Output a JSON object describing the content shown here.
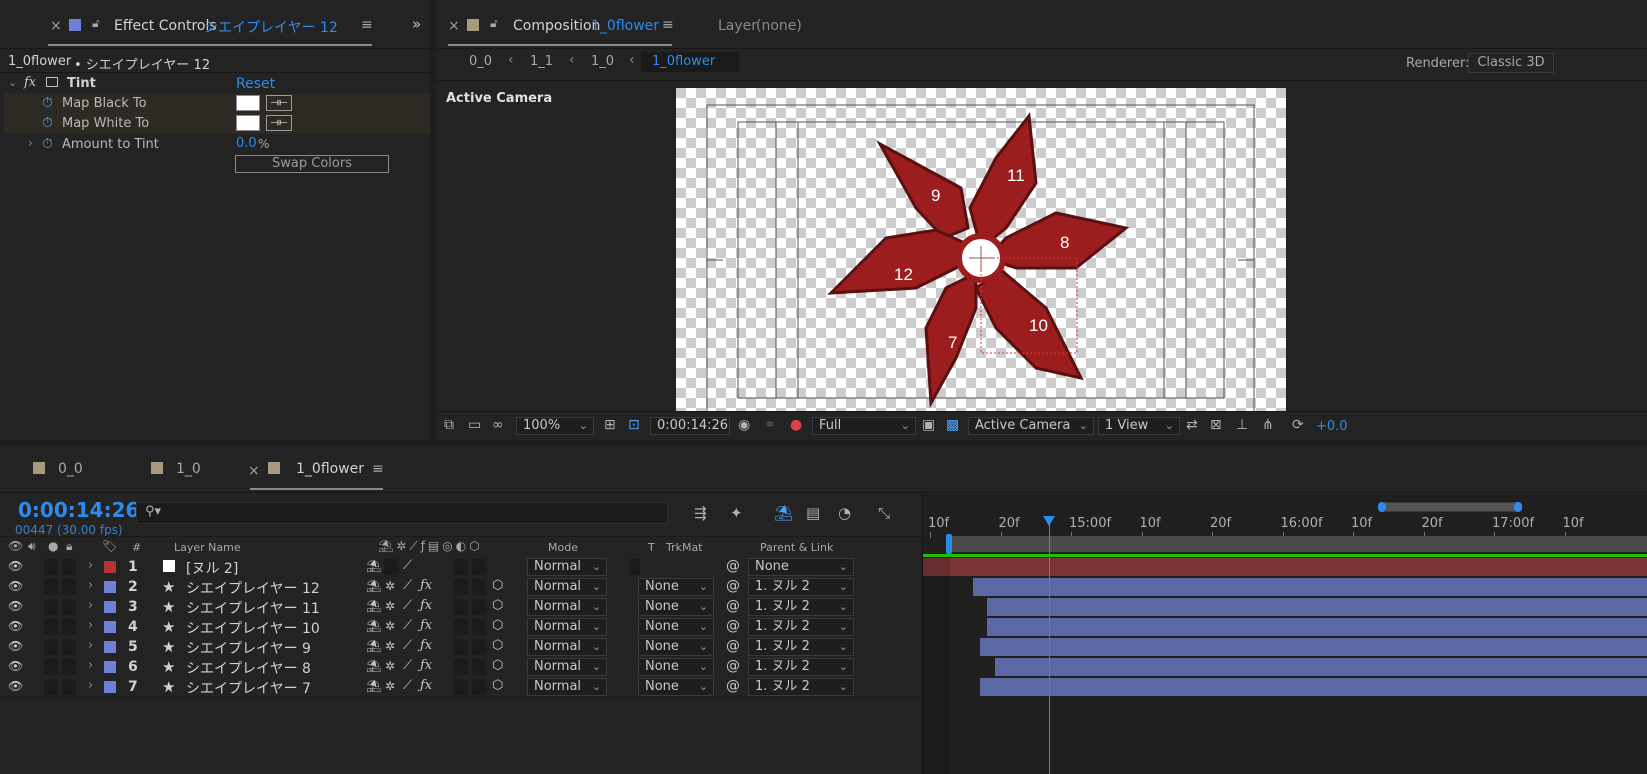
{
  "effect_controls": {
    "tab_title": "Effect Controls",
    "tab_layer": "シエイプレイヤー 12",
    "breadcrumb_comp": "1_0flower",
    "breadcrumb_layer": "• シエイプレイヤー 12",
    "effect_name": "Tint",
    "reset_label": "Reset",
    "properties": [
      {
        "label": "Map Black To",
        "value_color": "#ffffff"
      },
      {
        "label": "Map White To",
        "value_color": "#ffffff"
      },
      {
        "label": "Amount to Tint",
        "value": "0.0",
        "unit": "%"
      }
    ],
    "swap_label": "Swap Colors",
    "fx_label": "fx"
  },
  "composition": {
    "tab_title": "Composition",
    "tab_comp": "1_0flower",
    "layer_tab": "Layer",
    "layer_value": "(none)",
    "crumbs": [
      "0_0",
      "1_1",
      "1_0",
      "1_0flower"
    ],
    "renderer_label": "Renderer:",
    "renderer_value": "Classic 3D",
    "camera_label": "Active Camera",
    "petal_labels": [
      "9",
      "11",
      "8",
      "12",
      "7",
      "10"
    ]
  },
  "viewer_bar": {
    "zoom": "100%",
    "timecode": "0:00:14:26",
    "resolution": "Full",
    "camera": "Active Camera",
    "views": "1 View",
    "exposure": "+0.0"
  },
  "timeline": {
    "tabs": [
      {
        "label": "0_0",
        "color": "#a89a7e"
      },
      {
        "label": "1_0",
        "color": "#a89a7e"
      },
      {
        "label": "1_0flower",
        "color": "#a89a7e"
      }
    ],
    "current_time": "0:00:14:26",
    "frame_info": "00447 (30.00 fps)",
    "search_placeholder": "",
    "headers": {
      "hash": "#",
      "layer_name": "Layer Name",
      "mode": "Mode",
      "t": "T",
      "trkmat": "TrkMat",
      "parent": "Parent & Link"
    },
    "ruler_ticks": [
      "10f",
      "20f",
      "15:00f",
      "10f",
      "20f",
      "16:00f",
      "10f",
      "20f",
      "17:00f",
      "10f"
    ],
    "layers": [
      {
        "num": "1",
        "name": "[ヌル 2]",
        "label_color": "#b33535",
        "mode": "Normal",
        "trkmat": "",
        "parent": "None",
        "bar_start": 0.0,
        "type": "null"
      },
      {
        "num": "2",
        "name": "シエイプレイヤー 12",
        "label_color": "#6f7fd6",
        "mode": "Normal",
        "trkmat": "None",
        "parent": "1. ヌル 2",
        "bar_start": 0.07,
        "type": "shape"
      },
      {
        "num": "3",
        "name": "シエイプレイヤー 11",
        "label_color": "#6f7fd6",
        "mode": "Normal",
        "trkmat": "None",
        "parent": "1. ヌル 2",
        "bar_start": 0.09,
        "type": "shape"
      },
      {
        "num": "4",
        "name": "シエイプレイヤー 10",
        "label_color": "#6f7fd6",
        "mode": "Normal",
        "trkmat": "None",
        "parent": "1. ヌル 2",
        "bar_start": 0.09,
        "type": "shape"
      },
      {
        "num": "5",
        "name": "シエイプレイヤー 9",
        "label_color": "#6f7fd6",
        "mode": "Normal",
        "trkmat": "None",
        "parent": "1. ヌル 2",
        "bar_start": 0.08,
        "type": "shape"
      },
      {
        "num": "6",
        "name": "シエイプレイヤー 8",
        "label_color": "#6f7fd6",
        "mode": "Normal",
        "trkmat": "None",
        "parent": "1. ヌル 2",
        "bar_start": 0.1,
        "type": "shape"
      },
      {
        "num": "7",
        "name": "シエイプレイヤー 7",
        "label_color": "#6f7fd6",
        "mode": "Normal",
        "trkmat": "None",
        "parent": "1. ヌル 2",
        "bar_start": 0.08,
        "type": "shape"
      }
    ]
  }
}
